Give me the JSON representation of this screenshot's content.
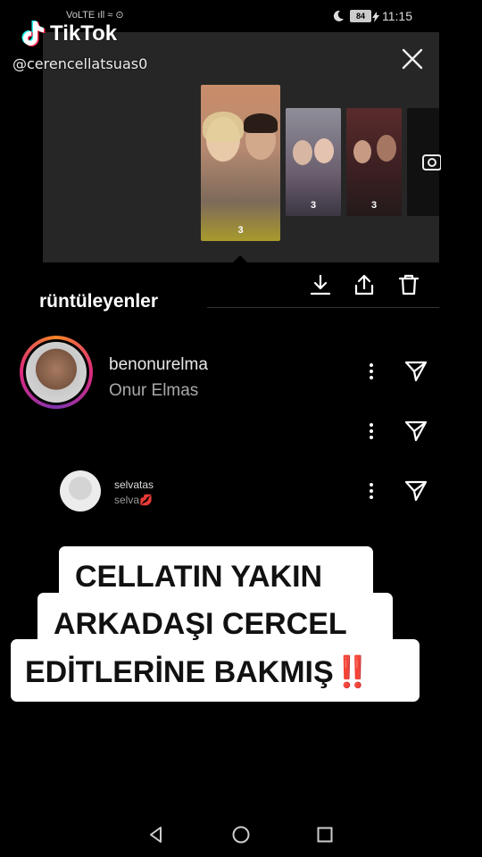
{
  "status_bar": {
    "left_icons": "VoLTE ıll ≈ ⊙",
    "time": "11:15",
    "battery": "84"
  },
  "tiktok": {
    "brand": "TikTok",
    "handle": "@cerencellatsuas0"
  },
  "stories": {
    "main_count": "3",
    "second_count": "3",
    "third_count": "3"
  },
  "viewers": {
    "title": "rüntüleyenler",
    "rows": [
      {
        "username": "benonurelma",
        "fullname": "Onur Elmas"
      },
      {
        "username": "",
        "fullname": ""
      },
      {
        "username": "selvatas",
        "fullname": "selva💋"
      }
    ]
  },
  "caption": {
    "line1": "CELLATIN YAKIN",
    "line2": "ARKADAŞI CERCEL",
    "line3": "EDİTLERİNE BAKMIŞ‼️"
  },
  "icons": {
    "close": "close-icon",
    "download": "download-icon",
    "share": "share-icon",
    "delete": "trash-icon",
    "more": "more-vertical-icon",
    "send": "send-icon",
    "camera": "camera-icon",
    "back": "back-icon",
    "home": "home-icon",
    "recents": "recents-icon"
  }
}
